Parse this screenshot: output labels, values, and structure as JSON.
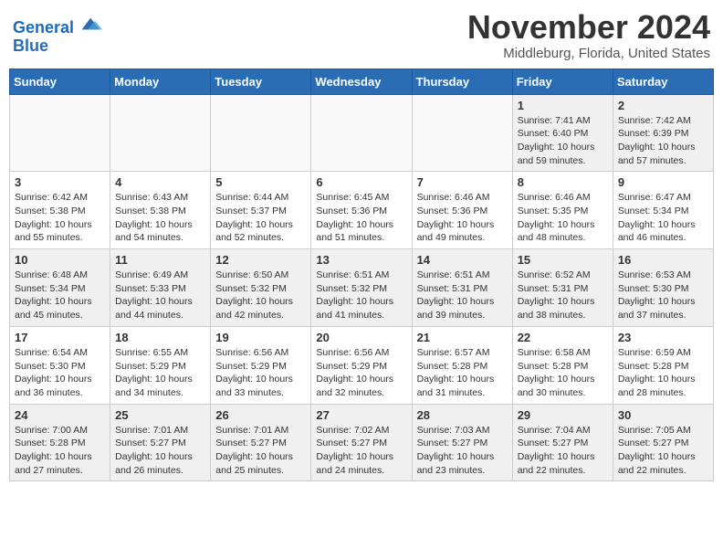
{
  "header": {
    "logo_line1": "General",
    "logo_line2": "Blue",
    "month": "November 2024",
    "location": "Middleburg, Florida, United States"
  },
  "weekdays": [
    "Sunday",
    "Monday",
    "Tuesday",
    "Wednesday",
    "Thursday",
    "Friday",
    "Saturday"
  ],
  "weeks": [
    [
      {
        "day": "",
        "info": ""
      },
      {
        "day": "",
        "info": ""
      },
      {
        "day": "",
        "info": ""
      },
      {
        "day": "",
        "info": ""
      },
      {
        "day": "",
        "info": ""
      },
      {
        "day": "1",
        "info": "Sunrise: 7:41 AM\nSunset: 6:40 PM\nDaylight: 10 hours and 59 minutes."
      },
      {
        "day": "2",
        "info": "Sunrise: 7:42 AM\nSunset: 6:39 PM\nDaylight: 10 hours and 57 minutes."
      }
    ],
    [
      {
        "day": "3",
        "info": "Sunrise: 6:42 AM\nSunset: 5:38 PM\nDaylight: 10 hours and 55 minutes."
      },
      {
        "day": "4",
        "info": "Sunrise: 6:43 AM\nSunset: 5:38 PM\nDaylight: 10 hours and 54 minutes."
      },
      {
        "day": "5",
        "info": "Sunrise: 6:44 AM\nSunset: 5:37 PM\nDaylight: 10 hours and 52 minutes."
      },
      {
        "day": "6",
        "info": "Sunrise: 6:45 AM\nSunset: 5:36 PM\nDaylight: 10 hours and 51 minutes."
      },
      {
        "day": "7",
        "info": "Sunrise: 6:46 AM\nSunset: 5:36 PM\nDaylight: 10 hours and 49 minutes."
      },
      {
        "day": "8",
        "info": "Sunrise: 6:46 AM\nSunset: 5:35 PM\nDaylight: 10 hours and 48 minutes."
      },
      {
        "day": "9",
        "info": "Sunrise: 6:47 AM\nSunset: 5:34 PM\nDaylight: 10 hours and 46 minutes."
      }
    ],
    [
      {
        "day": "10",
        "info": "Sunrise: 6:48 AM\nSunset: 5:34 PM\nDaylight: 10 hours and 45 minutes."
      },
      {
        "day": "11",
        "info": "Sunrise: 6:49 AM\nSunset: 5:33 PM\nDaylight: 10 hours and 44 minutes."
      },
      {
        "day": "12",
        "info": "Sunrise: 6:50 AM\nSunset: 5:32 PM\nDaylight: 10 hours and 42 minutes."
      },
      {
        "day": "13",
        "info": "Sunrise: 6:51 AM\nSunset: 5:32 PM\nDaylight: 10 hours and 41 minutes."
      },
      {
        "day": "14",
        "info": "Sunrise: 6:51 AM\nSunset: 5:31 PM\nDaylight: 10 hours and 39 minutes."
      },
      {
        "day": "15",
        "info": "Sunrise: 6:52 AM\nSunset: 5:31 PM\nDaylight: 10 hours and 38 minutes."
      },
      {
        "day": "16",
        "info": "Sunrise: 6:53 AM\nSunset: 5:30 PM\nDaylight: 10 hours and 37 minutes."
      }
    ],
    [
      {
        "day": "17",
        "info": "Sunrise: 6:54 AM\nSunset: 5:30 PM\nDaylight: 10 hours and 36 minutes."
      },
      {
        "day": "18",
        "info": "Sunrise: 6:55 AM\nSunset: 5:29 PM\nDaylight: 10 hours and 34 minutes."
      },
      {
        "day": "19",
        "info": "Sunrise: 6:56 AM\nSunset: 5:29 PM\nDaylight: 10 hours and 33 minutes."
      },
      {
        "day": "20",
        "info": "Sunrise: 6:56 AM\nSunset: 5:29 PM\nDaylight: 10 hours and 32 minutes."
      },
      {
        "day": "21",
        "info": "Sunrise: 6:57 AM\nSunset: 5:28 PM\nDaylight: 10 hours and 31 minutes."
      },
      {
        "day": "22",
        "info": "Sunrise: 6:58 AM\nSunset: 5:28 PM\nDaylight: 10 hours and 30 minutes."
      },
      {
        "day": "23",
        "info": "Sunrise: 6:59 AM\nSunset: 5:28 PM\nDaylight: 10 hours and 28 minutes."
      }
    ],
    [
      {
        "day": "24",
        "info": "Sunrise: 7:00 AM\nSunset: 5:28 PM\nDaylight: 10 hours and 27 minutes."
      },
      {
        "day": "25",
        "info": "Sunrise: 7:01 AM\nSunset: 5:27 PM\nDaylight: 10 hours and 26 minutes."
      },
      {
        "day": "26",
        "info": "Sunrise: 7:01 AM\nSunset: 5:27 PM\nDaylight: 10 hours and 25 minutes."
      },
      {
        "day": "27",
        "info": "Sunrise: 7:02 AM\nSunset: 5:27 PM\nDaylight: 10 hours and 24 minutes."
      },
      {
        "day": "28",
        "info": "Sunrise: 7:03 AM\nSunset: 5:27 PM\nDaylight: 10 hours and 23 minutes."
      },
      {
        "day": "29",
        "info": "Sunrise: 7:04 AM\nSunset: 5:27 PM\nDaylight: 10 hours and 22 minutes."
      },
      {
        "day": "30",
        "info": "Sunrise: 7:05 AM\nSunset: 5:27 PM\nDaylight: 10 hours and 22 minutes."
      }
    ]
  ]
}
